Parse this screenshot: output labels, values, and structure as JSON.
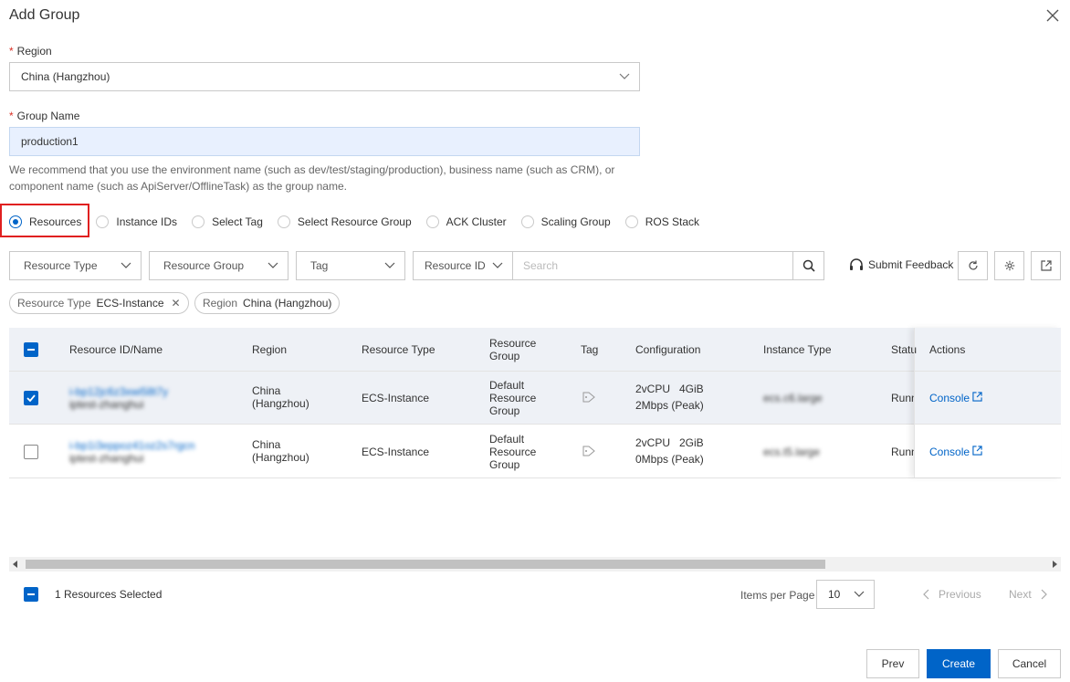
{
  "dialog": {
    "title": "Add Group"
  },
  "region": {
    "label": "Region",
    "value": "China (Hangzhou)"
  },
  "group_name": {
    "label": "Group Name",
    "value": "production1"
  },
  "hint": "We recommend that you use the environment name (such as dev/test/staging/production), business name (such as CRM), or component name (such as ApiServer/OfflineTask) as the group name.",
  "source_options": [
    {
      "label": "Resources",
      "checked": true
    },
    {
      "label": "Instance IDs",
      "checked": false
    },
    {
      "label": "Select Tag",
      "checked": false
    },
    {
      "label": "Select Resource Group",
      "checked": false
    },
    {
      "label": "ACK Cluster",
      "checked": false
    },
    {
      "label": "Scaling Group",
      "checked": false
    },
    {
      "label": "ROS Stack",
      "checked": false
    }
  ],
  "filters": {
    "resource_type": "Resource Type",
    "resource_group": "Resource Group",
    "tag": "Tag",
    "resource_id": "Resource ID",
    "search_placeholder": "Search",
    "submit_feedback": "Submit Feedback"
  },
  "chips": [
    {
      "key": "Resource Type",
      "value": "ECS-Instance",
      "removable": true
    },
    {
      "key": "Region",
      "value": "China (Hangzhou)",
      "removable": false
    }
  ],
  "table": {
    "columns": [
      "Resource ID/Name",
      "Region",
      "Resource Type",
      "Resource Group",
      "Tag",
      "Configuration",
      "Instance Type",
      "Statu",
      "Actions"
    ],
    "rows": [
      {
        "selected": true,
        "id": "i-bp12jc6z3xwi58t7y",
        "name": "iptest-zhanghui",
        "region": "China (Hangzhou)",
        "resource_type": "ECS-Instance",
        "resource_group": "Default Resource Group",
        "config_line1": "2vCPU   4GiB",
        "config_line2": "2Mbps (Peak)",
        "instance_type": "ecs.c6.large",
        "status": "Runn",
        "action": "Console"
      },
      {
        "selected": false,
        "id": "i-bp1i3eppoz41oz2s7rgcn",
        "name": "iptest-zhanghui",
        "region": "China (Hangzhou)",
        "resource_type": "ECS-Instance",
        "resource_group": "Default Resource Group",
        "config_line1": "2vCPU   2GiB",
        "config_line2": "0Mbps (Peak)",
        "instance_type": "ecs.t5.large",
        "status": "Runn",
        "action": "Console"
      }
    ]
  },
  "footer": {
    "selected_text": "1 Resources Selected",
    "items_per_page_label": "Items per Page",
    "items_per_page": "10",
    "previous": "Previous",
    "next": "Next"
  },
  "buttons": {
    "prev": "Prev",
    "create": "Create",
    "cancel": "Cancel"
  },
  "colors": {
    "primary": "#0064c8",
    "required": "#d93026",
    "highlight": "#e02020"
  }
}
